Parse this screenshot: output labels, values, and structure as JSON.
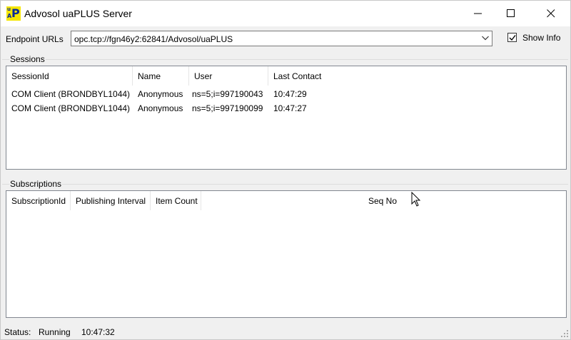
{
  "window": {
    "title": "Advosol uaPLUS Server",
    "icon_letters": {
      "u": "u",
      "a": "A",
      "p": "P"
    }
  },
  "endpoint": {
    "label": "Endpoint URLs",
    "value": "opc.tcp://fgn46y2:62841/Advosol/uaPLUS",
    "show_info_label": "Show Info",
    "show_info_checked": true
  },
  "sessions": {
    "title": "Sessions",
    "columns": [
      "SessionId",
      "Name",
      "User",
      "Last Contact"
    ],
    "rows": [
      [
        "COM Client (BRONDBYL1044)",
        "Anonymous",
        "ns=5;i=997190043",
        "10:47:29"
      ],
      [
        "COM Client (BRONDBYL1044)",
        "Anonymous",
        "ns=5;i=997190099",
        "10:47:27"
      ]
    ]
  },
  "subscriptions": {
    "title": "Subscriptions",
    "columns": [
      "SubscriptionId",
      "Publishing Interval",
      "Item Count",
      "Seq No"
    ],
    "rows": []
  },
  "status": {
    "label": "Status:",
    "state": "Running",
    "time": "10:47:32"
  }
}
